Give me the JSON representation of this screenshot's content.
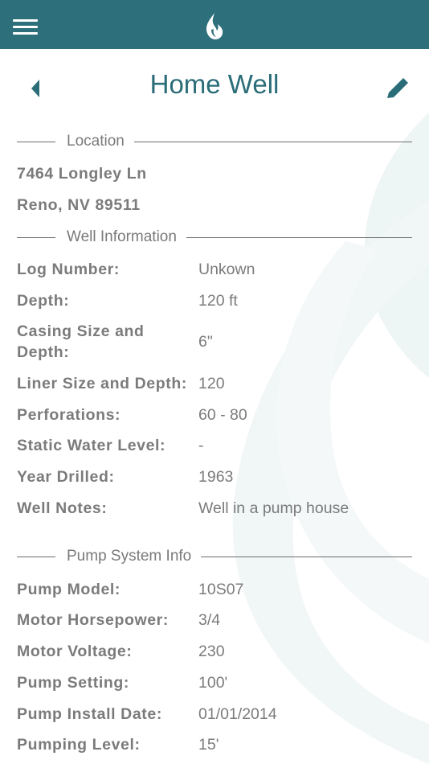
{
  "header": {
    "menu_icon": "hamburger-menu-icon",
    "logo_icon": "water-drop-logo-icon",
    "brand_color": "#2d6f7a"
  },
  "nav": {
    "title": "Home Well",
    "back_icon": "back-arrow-icon",
    "edit_icon": "pencil-edit-icon"
  },
  "location": {
    "heading": "Location",
    "address_line1": "7464 Longley Ln",
    "address_line2": "Reno, NV 89511"
  },
  "well_info": {
    "heading": "Well Information",
    "fields": [
      {
        "label": "Log Number:",
        "value": "Unkown"
      },
      {
        "label": "Depth:",
        "value": "120 ft"
      },
      {
        "label": "Casing Size and Depth:",
        "value": "6\""
      },
      {
        "label": "Liner Size and Depth:",
        "value": "120"
      },
      {
        "label": "Perforations:",
        "value": "60 - 80"
      },
      {
        "label": "Static Water Level:",
        "value": "-"
      },
      {
        "label": "Year Drilled:",
        "value": "1963"
      },
      {
        "label": "Well Notes:",
        "value": "Well in a pump house"
      }
    ]
  },
  "pump_info": {
    "heading": "Pump System Info",
    "fields": [
      {
        "label": "Pump Model:",
        "value": "10S07"
      },
      {
        "label": "Motor Horsepower:",
        "value": "3/4"
      },
      {
        "label": "Motor Voltage:",
        "value": "230"
      },
      {
        "label": "Pump Setting:",
        "value": "100'"
      },
      {
        "label": "Pump Install Date:",
        "value": "01/01/2014"
      },
      {
        "label": "Pumping Level:",
        "value": "15'"
      }
    ]
  }
}
